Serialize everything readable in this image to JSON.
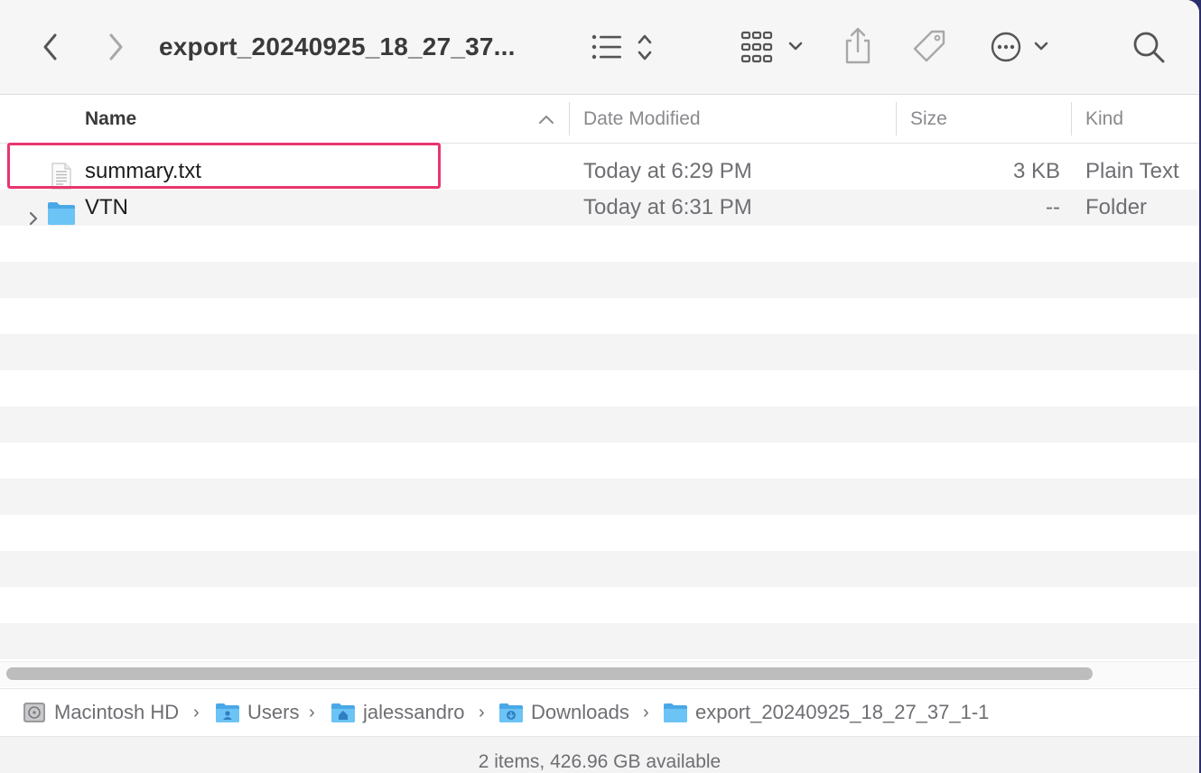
{
  "window": {
    "title": "export_20240925_18_27_37...",
    "toolbar": {
      "back_icon": "chevron-left-icon",
      "forward_icon": "chevron-right-icon",
      "list_view_icon": "list-view-icon",
      "grid_view_icon": "grid-view-icon",
      "share_icon": "share-icon",
      "tag_icon": "tag-icon",
      "more_icon": "ellipsis-circle-icon",
      "search_icon": "search-icon"
    }
  },
  "columns": {
    "name": "Name",
    "date_modified": "Date Modified",
    "size": "Size",
    "kind": "Kind",
    "sort": "ascending"
  },
  "files": [
    {
      "name": "summary.txt",
      "date_modified": "Today at 6:29 PM",
      "size": "3 KB",
      "kind": "Plain Text",
      "icon": "text-document-icon",
      "highlighted": true
    },
    {
      "name": "VTN",
      "date_modified": "Today at 6:31 PM",
      "size": "--",
      "kind": "Folder",
      "icon": "folder-icon",
      "expandable": true
    }
  ],
  "pathbar": {
    "items": [
      {
        "label": "Macintosh HD",
        "icon": "hard-drive-icon"
      },
      {
        "label": "Users",
        "icon": "users-folder-icon"
      },
      {
        "label": "jalessandro",
        "icon": "home-folder-icon"
      },
      {
        "label": "Downloads",
        "icon": "downloads-folder-icon"
      },
      {
        "label": "export_20240925_18_27_37_1-1",
        "icon": "folder-icon"
      }
    ]
  },
  "status": {
    "text": "2 items, 426.96 GB available"
  },
  "colors": {
    "highlight_border": "#e8356d",
    "folder_blue": "#5bbcf2",
    "alt_row": "#f4f4f5"
  }
}
